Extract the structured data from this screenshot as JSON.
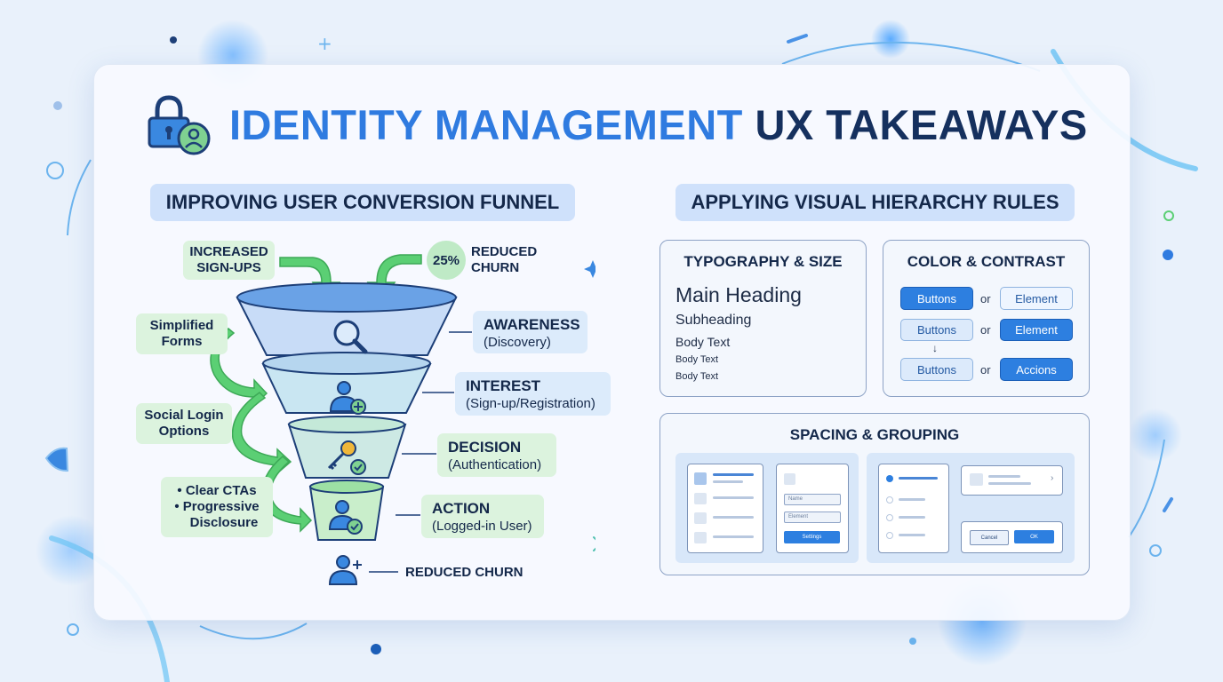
{
  "title": {
    "part1": "IDENTITY MANAGEMENT",
    "part2": "UX TAKEAWAYS"
  },
  "funnel_section": {
    "heading": "IMPROVING USER CONVERSION FUNNEL",
    "top_callouts": [
      {
        "text_line1": "INCREASED",
        "text_line2": "SIGN-UPS"
      },
      {
        "badge": "25%",
        "text_line1": "REDUCED",
        "text_line2": "CHURN"
      }
    ],
    "side_callouts": [
      {
        "line1": "Simplified",
        "line2": "Forms"
      },
      {
        "line1": "Social Login",
        "line2": "Options"
      },
      {
        "line1": "• Clear CTAs",
        "line2": "• Progressive",
        "line3": "Disclosure"
      }
    ],
    "stages": [
      {
        "name": "AWARENESS",
        "sub": "(Discovery)",
        "icon": "magnifier-icon"
      },
      {
        "name": "INTEREST",
        "sub": "(Sign-up/Registration)",
        "icon": "user-add-icon"
      },
      {
        "name": "DECISION",
        "sub": "(Authentication)",
        "icon": "key-check-icon"
      },
      {
        "name": "ACTION",
        "sub": "(Logged-in User)",
        "icon": "user-check-icon"
      }
    ],
    "outcome": "REDUCED CHURN"
  },
  "hierarchy_section": {
    "heading": "APPLYING VISUAL HIERARCHY RULES",
    "typography": {
      "heading": "TYPOGRAPHY & SIZE",
      "samples": [
        "Main Heading",
        "Subheading",
        "Body Text",
        "Body Text",
        "Body Text"
      ]
    },
    "color": {
      "heading": "COLOR & CONTRAST",
      "rows": [
        {
          "left": "Buttons",
          "or": "or",
          "right": "Element"
        },
        {
          "left": "Buttons",
          "or": "or",
          "right": "Element"
        },
        {
          "left": "Buttons",
          "or": "or",
          "right": "Accions"
        }
      ],
      "down_arrow": "↓"
    },
    "spacing": {
      "heading": "SPACING & GROUPING",
      "form_fields": [
        "Name",
        "Element"
      ],
      "form_button": "Settings",
      "dialog_cancel": "Cancel",
      "dialog_ok": "OK"
    }
  },
  "colors": {
    "accent_blue": "#2f7be0",
    "navy": "#15305e",
    "green": "#5bcf74",
    "light_blue": "#cfe1fb",
    "light_green": "#dcf3de"
  }
}
